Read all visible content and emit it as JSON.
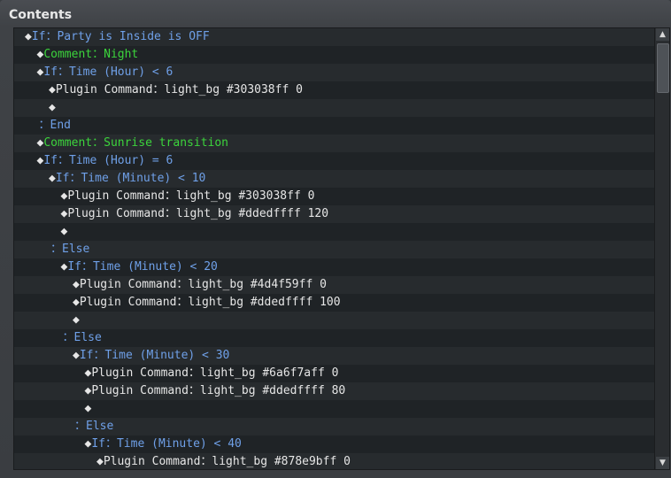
{
  "panel": {
    "title": "Contents"
  },
  "rows": [
    {
      "indent": 0,
      "diamond": true,
      "parts": [
        {
          "text": "If：Party is Inside is OFF",
          "color": "blue"
        }
      ]
    },
    {
      "indent": 1,
      "diamond": true,
      "parts": [
        {
          "text": "Comment：Night",
          "color": "green"
        }
      ]
    },
    {
      "indent": 1,
      "diamond": true,
      "parts": [
        {
          "text": "If：Time (Hour) < 6",
          "color": "blue"
        }
      ]
    },
    {
      "indent": 2,
      "diamond": true,
      "parts": [
        {
          "text": "Plugin Command：light_bg #303038ff 0",
          "color": "white"
        }
      ]
    },
    {
      "indent": 2,
      "diamond": true,
      "parts": []
    },
    {
      "indent": 1,
      "diamond": false,
      "parts": [
        {
          "text": "：End",
          "color": "blue"
        }
      ]
    },
    {
      "indent": 1,
      "diamond": true,
      "parts": [
        {
          "text": "Comment：Sunrise transition",
          "color": "green"
        }
      ]
    },
    {
      "indent": 1,
      "diamond": true,
      "parts": [
        {
          "text": "If：Time (Hour) = 6",
          "color": "blue"
        }
      ]
    },
    {
      "indent": 2,
      "diamond": true,
      "parts": [
        {
          "text": "If：Time (Minute) < 10",
          "color": "blue"
        }
      ]
    },
    {
      "indent": 3,
      "diamond": true,
      "parts": [
        {
          "text": "Plugin Command：light_bg #303038ff 0",
          "color": "white"
        }
      ]
    },
    {
      "indent": 3,
      "diamond": true,
      "parts": [
        {
          "text": "Plugin Command：light_bg #ddedffff 120",
          "color": "white"
        }
      ]
    },
    {
      "indent": 3,
      "diamond": true,
      "parts": []
    },
    {
      "indent": 2,
      "diamond": false,
      "parts": [
        {
          "text": "：Else",
          "color": "blue"
        }
      ]
    },
    {
      "indent": 3,
      "diamond": true,
      "parts": [
        {
          "text": "If：Time (Minute) < 20",
          "color": "blue"
        }
      ]
    },
    {
      "indent": 4,
      "diamond": true,
      "parts": [
        {
          "text": "Plugin Command：light_bg #4d4f59ff 0",
          "color": "white"
        }
      ]
    },
    {
      "indent": 4,
      "diamond": true,
      "parts": [
        {
          "text": "Plugin Command：light_bg #ddedffff 100",
          "color": "white"
        }
      ]
    },
    {
      "indent": 4,
      "diamond": true,
      "parts": []
    },
    {
      "indent": 3,
      "diamond": false,
      "parts": [
        {
          "text": "：Else",
          "color": "blue"
        }
      ]
    },
    {
      "indent": 4,
      "diamond": true,
      "parts": [
        {
          "text": "If：Time (Minute) < 30",
          "color": "blue"
        }
      ]
    },
    {
      "indent": 5,
      "diamond": true,
      "parts": [
        {
          "text": "Plugin Command：light_bg #6a6f7aff 0",
          "color": "white"
        }
      ]
    },
    {
      "indent": 5,
      "diamond": true,
      "parts": [
        {
          "text": "Plugin Command：light_bg #ddedffff 80",
          "color": "white"
        }
      ]
    },
    {
      "indent": 5,
      "diamond": true,
      "parts": []
    },
    {
      "indent": 4,
      "diamond": false,
      "parts": [
        {
          "text": "：Else",
          "color": "blue"
        }
      ]
    },
    {
      "indent": 5,
      "diamond": true,
      "parts": [
        {
          "text": "If：Time (Minute) < 40",
          "color": "blue"
        }
      ]
    },
    {
      "indent": 6,
      "diamond": true,
      "parts": [
        {
          "text": "Plugin Command：light_bg #878e9bff 0",
          "color": "white"
        }
      ]
    }
  ],
  "scrollbar": {
    "up_glyph": "▲",
    "down_glyph": "▼"
  }
}
